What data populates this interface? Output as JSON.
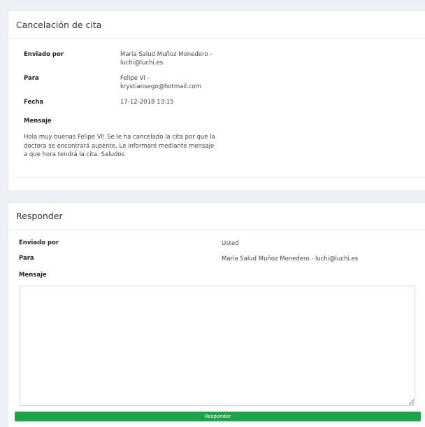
{
  "message": {
    "title": "Cancelación de cita",
    "sent_by_label": "Enviado por",
    "sent_by_value": "María Salud Muñoz Monedero - luchi@luchi.es",
    "to_label": "Para",
    "to_value": "Felipe VI - krystiansego@hotmail.com",
    "date_label": "Fecha",
    "date_value": "17-12-2018 13:15",
    "message_label": "Mensaje",
    "message_body": "Hola muy buenas Felipe VI! Se le ha cancelado la cita por que la doctora se encontrará ausente. Le informaré mediante mensaje a que hora tendrá la cita. Saludos"
  },
  "reply": {
    "title": "Responder",
    "sent_by_label": "Enviado por",
    "sent_by_value": "Usted",
    "to_label": "Para",
    "to_value": "María Salud Muñoz Monedero - luchi@luchi.es",
    "message_label": "Mensaje",
    "message_value": "",
    "submit_label": "Responder"
  }
}
